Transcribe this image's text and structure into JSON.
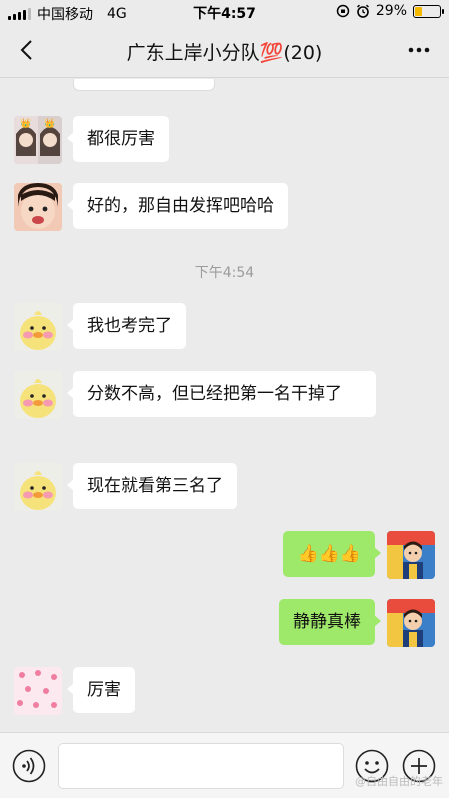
{
  "status_bar": {
    "carrier": "中国移动",
    "network": "4G",
    "time": "下午4:57",
    "battery": "29%",
    "battery_level": 0.29
  },
  "header": {
    "title": "广东上岸小分队💯(20)"
  },
  "timestamp": "下午4:54",
  "messages": [
    {
      "side": "left",
      "avatar": "avatar-girls-pair",
      "text": "都很厉害"
    },
    {
      "side": "left",
      "avatar": "avatar-little-girl",
      "text": "好的，那自由发挥吧哈哈"
    },
    {
      "side": "left",
      "avatar": "avatar-yellow-duck",
      "text": "我也考完了"
    },
    {
      "side": "left",
      "avatar": "avatar-yellow-duck",
      "text": "分数不高，但已经把第一名干掉了"
    },
    {
      "side": "left",
      "avatar": "avatar-yellow-duck",
      "text": "现在就看第三名了"
    },
    {
      "side": "right",
      "avatar": "avatar-boy",
      "text": "👍👍👍"
    },
    {
      "side": "right",
      "avatar": "avatar-boy",
      "text": "静静真棒"
    },
    {
      "side": "left",
      "avatar": "avatar-pink-pattern",
      "text": "厉害"
    }
  ],
  "watermark": "@自由自由的老年"
}
